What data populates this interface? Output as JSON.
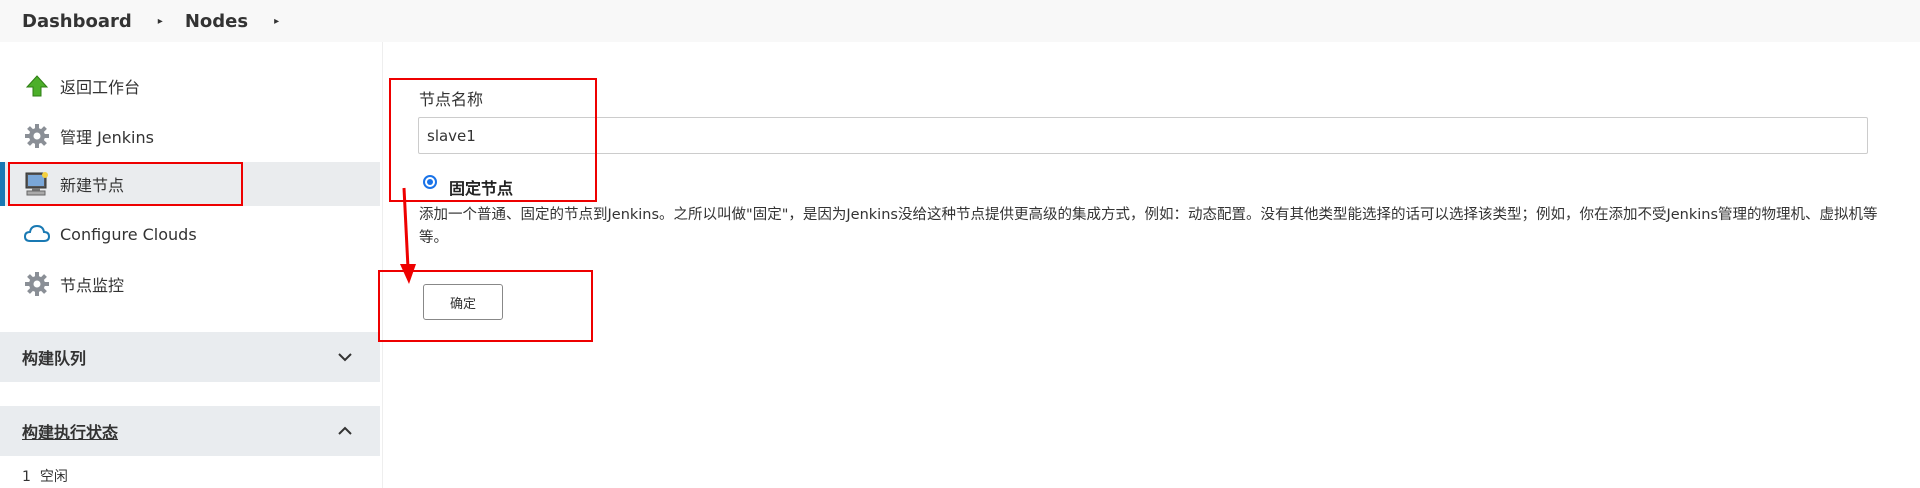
{
  "breadcrumb": {
    "items": [
      "Dashboard",
      "Nodes"
    ],
    "separator": "▸"
  },
  "sidebar": {
    "tasks": [
      {
        "label": "返回工作台",
        "icon": "up-arrow-icon"
      },
      {
        "label": "管理 Jenkins",
        "icon": "gear-icon"
      },
      {
        "label": "新建节点",
        "icon": "computer-icon",
        "active": true
      },
      {
        "label": "Configure Clouds",
        "icon": "cloud-icon"
      },
      {
        "label": "节点监控",
        "icon": "gear-icon"
      }
    ],
    "build_queue": {
      "title": "构建队列",
      "collapsed": true
    },
    "executor_status": {
      "title": "构建执行状态",
      "expanded": true,
      "rows": [
        {
          "index": "1",
          "status": "空闲"
        }
      ]
    }
  },
  "form": {
    "name_label": "节点名称",
    "name_value": "slave1",
    "node_type_label": "固定节点",
    "node_type_selected": true,
    "description": "添加一个普通、固定的节点到Jenkins。之所以叫做\"固定\"，是因为Jenkins没给这种节点提供更高级的集成方式，例如：动态配置。没有其他类型能选择的话可以选择该类型；例如，你在添加不受Jenkins管理的物理机、虚拟机等等。",
    "ok_label": "确定"
  },
  "colors": {
    "annotation": "#e00000",
    "active_indicator": "#1979b3",
    "radio": "#1a73e8"
  }
}
